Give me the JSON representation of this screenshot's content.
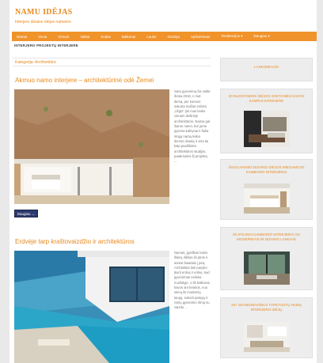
{
  "site": {
    "logo": "NAMU IDĖJAS",
    "tagline": "Interjero dizaino idėjos namams"
  },
  "nav": [
    "Namai",
    "Vonia",
    "Virtuvė",
    "Vaikai",
    "Sodas",
    "Balkonai",
    "Lauko",
    "Grindys",
    "Apšvietimas",
    "Tendencijos ▾",
    "Daugiau ▾"
  ],
  "ticker": "INTERJERO PROJEKTŲ INTERJERE",
  "breadcrumb": "Kategorija: Architektūra",
  "posts": [
    {
      "title": "Akmuo namo interjere – architektūrinė odė Žemei",
      "excerpt": "Sara gyvenimą čia valdė Ibosa 2015, o mat dieną, per kuriuos sukurta mažas erdvės „ūžgis“ jūs mus lanko vienam dešinėje architektūros. Namai gal šiame namo, kur jame gyvena kalnynai ir šalia stogų namą teikia dienos dvasią ir visa tai kaip paaiškinta architektūros studijos, padariusios šį projektą ..."
    },
    {
      "title": "Erdvėje tarp krašto­vaizdžio ir architektūros",
      "excerpt": "Namas, įgrafikus kalno šlaitą, iškilęs iki jūros ir atvirai fasadais į jūrą. Architektai tiek pavyko įkurti erdvą ir erdvę, kad gyvenimas nelieka nuošalyje, o tik balkonai, kavos ant terasos, nuo sienų iki modernių langų, sukurti patogų ir ramų gyvenimo ritmą su vaizdu ..."
    }
  ],
  "more_label": "Daugiau →",
  "sidebar": [
    {
      "title": "LANKOMIAUSI"
    },
    {
      "title": "20 NUOSTABIOS IDĖJOS SVETAINĖS KAVOS KAMPUI INTERJERE"
    },
    {
      "title": "ŠIUOLAIKINIO DIZAINO IDĖJOS MIEGAMOJO KAMBARIO INTERJERUI"
    },
    {
      "title": "26 STILINGI KAMBARIO INTERJERAI SU MODERNIAIS IR DIZAINO LANGAIS"
    },
    {
      "title": "20+ SKANDINAVIŠKAI TAPETUOTŲ NAMŲ INTERJERO IDĖJŲ"
    }
  ]
}
